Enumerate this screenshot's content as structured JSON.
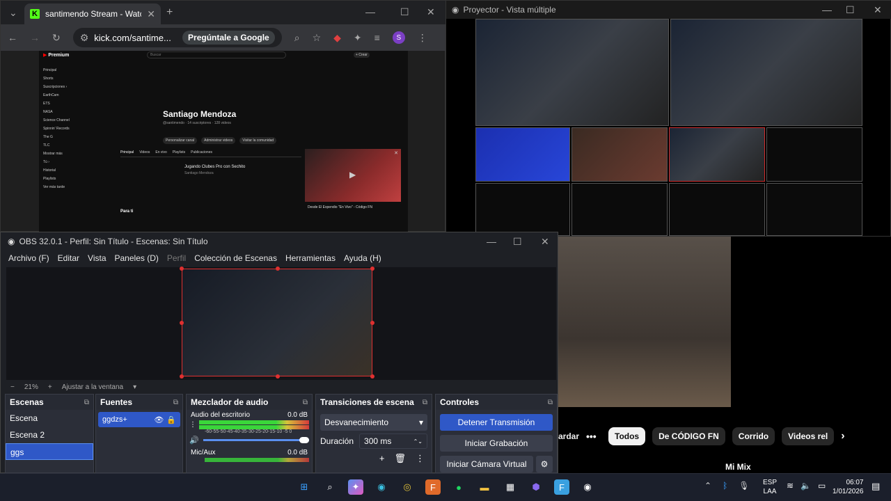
{
  "chrome": {
    "tab_title": "santimendo Stream - Watch Liv",
    "url": "kick.com/santime...",
    "google_button": "Pregúntale a Google",
    "profile_initial": "S"
  },
  "youtube": {
    "brand": "Premium",
    "search_placeholder": "Buscar",
    "create_label": "+ Crear",
    "sidebar": [
      "Principal",
      "Shorts",
      "Suscripciones ›",
      "EarthCam",
      "ETS",
      "NASA",
      "Science Channel",
      "Spinnin' Records",
      "The G",
      "TLC",
      "Mostrar más",
      "Tú ›",
      "Historial",
      "Playlists",
      "Ver más tarde"
    ],
    "channel_name": "Santiago Mendoza",
    "channel_meta": "@santimendo · 14 suscriptores · 128 videos",
    "buttons": [
      "Personalizar canal",
      "Administrar videos",
      "Visitar la comunidad"
    ],
    "tabs": [
      "Principal",
      "Videos",
      "En vivo",
      "Playlists",
      "Publicaciones"
    ],
    "video_title": "Jugando Clubes Pro con Sechito",
    "video_author": "Santiago Mendoza",
    "para_ti": "Para ti",
    "mini_title": "Desde El Expendio \"En Vivo\" - Código FN"
  },
  "projector": {
    "title": "Proyector - Vista múltiple"
  },
  "obs": {
    "title": "OBS 32.0.1 - Perfil: Sin Título - Escenas: Sin Título",
    "menu": [
      "Archivo (F)",
      "Editar",
      "Vista",
      "Paneles (D)",
      "Perfil",
      "Colección de Escenas",
      "Herramientas",
      "Ayuda (H)"
    ],
    "zoom": "21%",
    "fit_label": "Ajustar a la ventana",
    "docks": {
      "scenes": "Escenas",
      "sources": "Fuentes",
      "mixer": "Mezclador de audio",
      "transitions": "Transiciones de escena",
      "controls": "Controles"
    },
    "scenes": [
      "Escena",
      "Escena 2",
      "ggs"
    ],
    "source": "ggdzs+",
    "mixer": [
      {
        "name": "Audio del escritorio",
        "db": "0.0 dB"
      },
      {
        "name": "Mic/Aux",
        "db": "0.0 dB"
      }
    ],
    "meter_scale": "-60-55-50-45-40-35-30-25-20-15-10 -5  0",
    "transition": "Desvanecimiento",
    "duration_label": "Duración",
    "duration_value": "300 ms",
    "controls": [
      "Detener Transmisión",
      "Iniciar Grabación",
      "Iniciar Cámara Virtual"
    ]
  },
  "video_panel": {
    "chips": [
      "Todos",
      "De CÓDIGO FN",
      "Corrido",
      "Videos rel"
    ],
    "save_partial": "ardar",
    "next_item": "Mi Mix"
  },
  "taskbar": {
    "lang": "ESP",
    "lang2": "LAA",
    "time": "06:07",
    "date": "1/01/2026"
  }
}
